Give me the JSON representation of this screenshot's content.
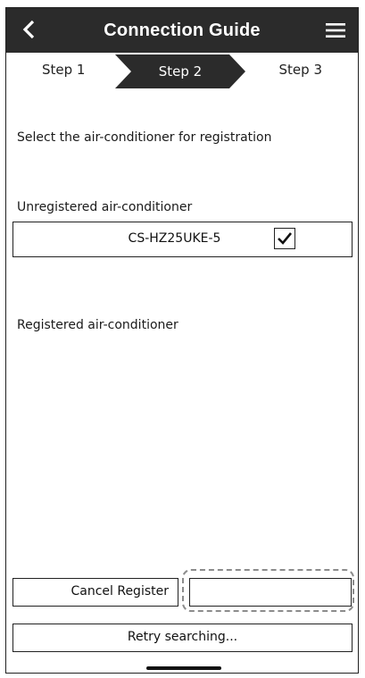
{
  "header": {
    "title": "Connection Guide",
    "back_icon": "chevron-left-icon",
    "menu_icon": "hamburger-menu-icon"
  },
  "steps": [
    {
      "label": "Step 1",
      "active": false
    },
    {
      "label": "Step 2",
      "active": true
    },
    {
      "label": "Step 3",
      "active": false
    }
  ],
  "main": {
    "instruction": "Select the air-conditioner for registration",
    "unregistered_label": "Unregistered air-conditioner",
    "unregistered_devices": [
      {
        "name": "CS-HZ25UKE-5",
        "checked": true
      }
    ],
    "registered_label": "Registered air-conditioner"
  },
  "buttons": {
    "cancel_register": "Cancel Register",
    "register": "",
    "retry": "Retry searching..."
  },
  "colors": {
    "header_bg": "#2b2b2b",
    "active_step_bg": "#2b2b2b",
    "highlight_dash": "#8c8c8c"
  }
}
